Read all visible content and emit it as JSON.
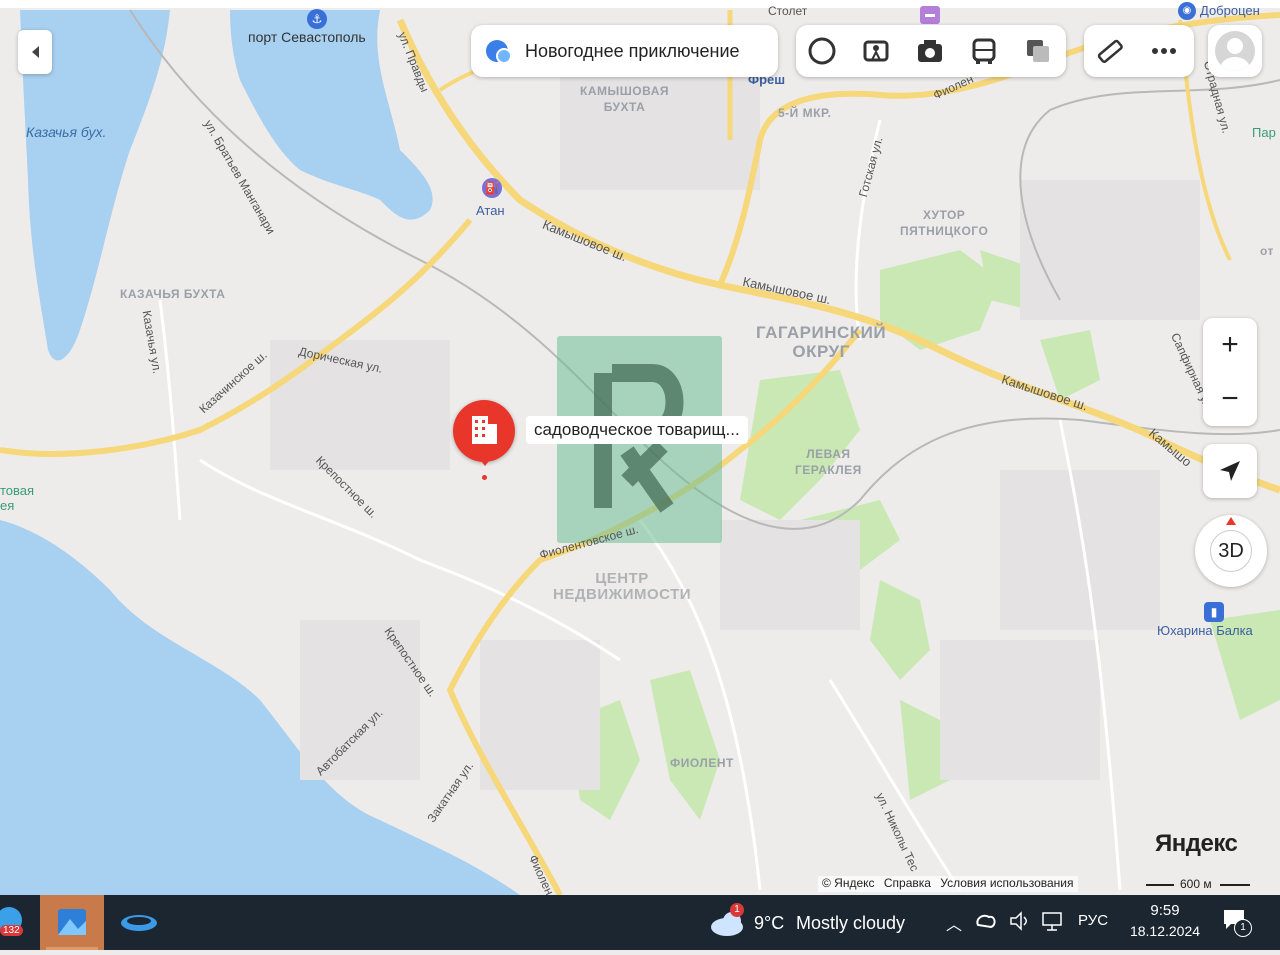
{
  "promo": {
    "label": "Новогоднее приключение"
  },
  "toolbar": {
    "icons": [
      "alice-icon",
      "panorama-icon",
      "photo-icon",
      "transport-icon",
      "layers-icon",
      "ruler-icon",
      "more-icon"
    ]
  },
  "marker": {
    "label": "садоводческое товарищ..."
  },
  "labels": {
    "port": "порт Севастополь",
    "kazachya_bay": "Казачья бух.",
    "atan": "Атан",
    "kamyshovaya_bukhta": "КАМЫШОВАЯ\nБУХТА",
    "fresh": "Фреш",
    "mkr5": "5-Й МКР.",
    "stolet": "Столет",
    "dobrotsen": "Доброцен",
    "khutor": "ХУТОР\nПЯТНИЦКОГО",
    "gagarinsky": "ГАГАРИНСКИЙ\nОКРУГ",
    "kazachya_bukhta_district": "КАЗАЧЬЯ БУХТА",
    "levaya_gerakleya": "ЛЕВАЯ\nГЕРАКЛЕЯ",
    "fiolent": "ФИОЛЕНТ",
    "yukharina": "Юхарина Балка",
    "tsentr": "ЦЕНТР\nНЕДВИЖИМОСТИ",
    "par": "Пар",
    "ot": "от",
    "tovaya": "товая\nея",
    "streets": {
      "pravdy": "ул. Правды",
      "bratyev": "ул. Братьев Манганари",
      "kamyshovoe1": "Камышовое ш.",
      "kamyshovoe2": "Камышовое ш.",
      "kamyshovoe3": "Камышовое ш.",
      "kamyshovoe4": "Камышо",
      "gotskaya": "Готская ул.",
      "fiolentovskoe_top": "Фиолен",
      "otradnaya": "Отрадная ул.",
      "kazachinskoe": "Казачинское ш.",
      "doricheskaya": "Дорическая ул.",
      "kazachya": "Казачья ул.",
      "krepostnoe1": "Крепостное ш.",
      "krepostnoe2": "Крепостное ш.",
      "fiolentovskoe": "Фиолентовское ш.",
      "avtobatskaya": "Автобатская ул.",
      "zakatnaya": "Закатная ул.",
      "fiolent_bottom": "Фиолен",
      "safirnaya": "Сапфирная ул.",
      "nikoly": "ул. Николы Тес"
    }
  },
  "controls": {
    "zoom_in": "+",
    "zoom_out": "−",
    "compass_3d": "3D"
  },
  "footer": {
    "brand": "Яндекс",
    "copyright": "© Яндекс",
    "help": "Справка",
    "terms": "Условия использования",
    "scale": "600 м"
  },
  "taskbar": {
    "badge_count": "132",
    "weather_badge": "1",
    "temperature": "9°C",
    "weather": "Mostly cloudy",
    "language": "РУС",
    "time": "9:59",
    "date": "18.12.2024",
    "notification_count": "1"
  },
  "colors": {
    "road_major": "#f6d77a",
    "water": "#a8d0f0",
    "park": "#c9e8b4",
    "marker": "#e8372a",
    "taskbar": "#1b2631"
  }
}
